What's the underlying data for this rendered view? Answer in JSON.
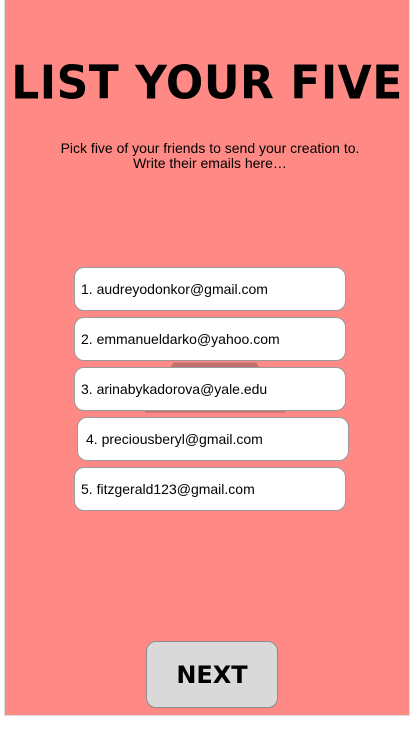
{
  "header": {
    "title": "LIST YOUR FIVE",
    "subtitle_line1": "Pick five of your friends to send your creation to.",
    "subtitle_line2": "Write their emails here…"
  },
  "emails": [
    {
      "value": "1. audreyodonkor@gmail.com"
    },
    {
      "value": "2. emmanueldarko@yahoo.com"
    },
    {
      "value": "3. arinabykadorova@yale.edu"
    },
    {
      "value": "4. preciousberyl@gmail.com"
    },
    {
      "value": "5. fitzgerald123@gmail.com"
    }
  ],
  "actions": {
    "next_label": "NEXT"
  },
  "colors": {
    "background": "#ff8a85",
    "field": "#ffffff",
    "button": "#d9d9d9"
  }
}
